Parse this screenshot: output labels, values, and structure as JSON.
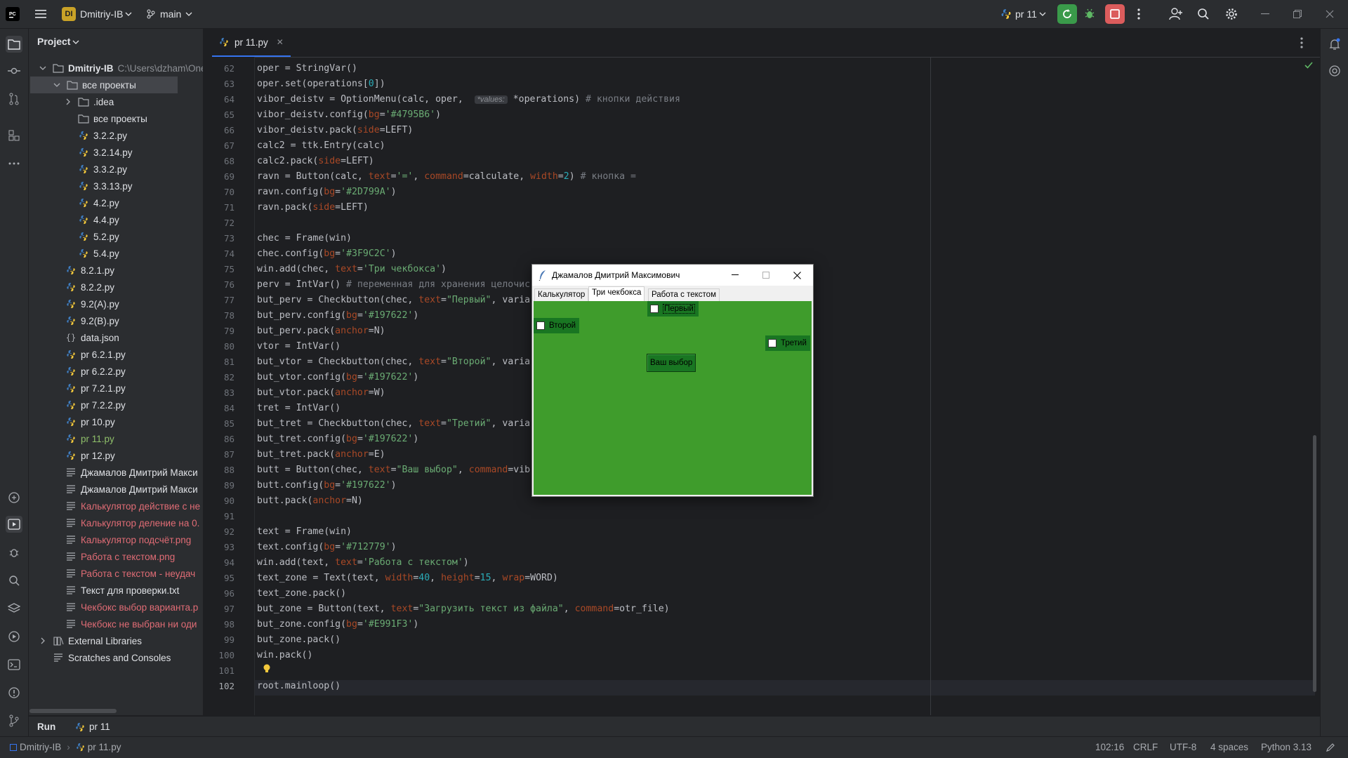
{
  "titlebar": {
    "project_badge": "DI",
    "project_name": "Dmitriy-IB",
    "branch": "main",
    "run_config": "pr 11"
  },
  "project_panel": {
    "title": "Project",
    "root_name": "Dmitriy-IB",
    "root_path": "C:\\Users\\dzham\\One",
    "items": [
      {
        "label": "все проекты",
        "kind": "folder",
        "depth": 1,
        "expanded": true,
        "selected": true
      },
      {
        "label": ".idea",
        "kind": "folder",
        "depth": 2,
        "expanded": false
      },
      {
        "label": "все проекты",
        "kind": "folder",
        "depth": 2
      },
      {
        "label": "3.2.2.py",
        "kind": "py",
        "depth": 2
      },
      {
        "label": "3.2.14.py",
        "kind": "py",
        "depth": 2
      },
      {
        "label": "3.3.2.py",
        "kind": "py",
        "depth": 2
      },
      {
        "label": "3.3.13.py",
        "kind": "py",
        "depth": 2
      },
      {
        "label": "4.2.py",
        "kind": "py",
        "depth": 2
      },
      {
        "label": "4.4.py",
        "kind": "py",
        "depth": 2
      },
      {
        "label": "5.2.py",
        "kind": "py",
        "depth": 2
      },
      {
        "label": "5.4.py",
        "kind": "py",
        "depth": 2
      },
      {
        "label": "8.2.1.py",
        "kind": "py",
        "depth": 1
      },
      {
        "label": "8.2.2.py",
        "kind": "py",
        "depth": 1
      },
      {
        "label": "9.2(A).py",
        "kind": "py",
        "depth": 1
      },
      {
        "label": "9.2(B).py",
        "kind": "py",
        "depth": 1
      },
      {
        "label": "data.json",
        "kind": "json",
        "depth": 1
      },
      {
        "label": "pr 6.2.1.py",
        "kind": "py",
        "depth": 1
      },
      {
        "label": "pr 6.2.2.py",
        "kind": "py",
        "depth": 1
      },
      {
        "label": "pr 7.2.1.py",
        "kind": "py",
        "depth": 1
      },
      {
        "label": "pr 7.2.2.py",
        "kind": "py",
        "depth": 1
      },
      {
        "label": "pr 10.py",
        "kind": "py",
        "depth": 1
      },
      {
        "label": "pr 11.py",
        "kind": "py-active",
        "depth": 1
      },
      {
        "label": "pr 12.py",
        "kind": "py",
        "depth": 1
      },
      {
        "label": "Джамалов Дмитрий Макси",
        "kind": "text",
        "depth": 1
      },
      {
        "label": "Джамалов Дмитрий Макси",
        "kind": "text",
        "depth": 1
      },
      {
        "label": "Калькулятор действие с не",
        "kind": "image",
        "depth": 1
      },
      {
        "label": "Калькулятор деление на 0.",
        "kind": "image",
        "depth": 1
      },
      {
        "label": "Калькулятор подсчёт.png",
        "kind": "image",
        "depth": 1
      },
      {
        "label": "Работа с текстом.png",
        "kind": "image",
        "depth": 1
      },
      {
        "label": "Работа с текстом - неудач",
        "kind": "image",
        "depth": 1
      },
      {
        "label": "Текст для проверки.txt",
        "kind": "text",
        "depth": 1
      },
      {
        "label": "Чекбокс выбор варианта.p",
        "kind": "image",
        "depth": 1
      },
      {
        "label": "Чекбокс не выбран ни оди",
        "kind": "image",
        "depth": 1
      },
      {
        "label": "External Libraries",
        "kind": "lib",
        "depth": 0
      },
      {
        "label": "Scratches and Consoles",
        "kind": "scratch",
        "depth": 0
      }
    ]
  },
  "editor": {
    "tab_label": "pr 11.py",
    "first_line": 62,
    "lines": [
      "oper = StringVar()",
      "oper.set(operations[0])",
      "vibor_deistv = OptionMenu(calc, oper,  *values: *operations) # кнопки действия",
      "vibor_deistv.config(bg='#4795B6')",
      "vibor_deistv.pack(side=LEFT)",
      "calc2 = ttk.Entry(calc)",
      "calc2.pack(side=LEFT)",
      "ravn = Button(calc, text='=', command=calculate, width=2) # кнопка =",
      "ravn.config(bg='#2D799A')",
      "ravn.pack(side=LEFT)",
      "",
      "chec = Frame(win)",
      "chec.config(bg='#3F9C2C')",
      "win.add(chec, text='Три чекбокса')",
      "perv = IntVar() # переменная для хранения целочис",
      "but_perv = Checkbutton(chec, text=\"Первый\", varia",
      "but_perv.config(bg='#197622')",
      "but_perv.pack(anchor=N)",
      "vtor = IntVar()",
      "but_vtor = Checkbutton(chec, text=\"Второй\", varia",
      "but_vtor.config(bg='#197622')",
      "but_vtor.pack(anchor=W)",
      "tret = IntVar()",
      "but_tret = Checkbutton(chec, text=\"Третий\", varia",
      "but_tret.config(bg='#197622')",
      "but_tret.pack(anchor=E)",
      "butt = Button(chec, text=\"Ваш выбор\", command=vib",
      "butt.config(bg='#197622')",
      "butt.pack(anchor=N)",
      "",
      "text = Frame(win)",
      "text.config(bg='#712779')",
      "win.add(text, text='Работа с текстом')",
      "text_zone = Text(text, width=40, height=15, wrap=WORD)",
      "text_zone.pack()",
      "but_zone = Button(text, text=\"Загрузить текст из файла\", command=otr_file)",
      "but_zone.config(bg='#E991F3')",
      "but_zone.pack()",
      "win.pack()",
      "",
      "root.mainloop()"
    ]
  },
  "tk_window": {
    "title": "Джамалов Дмитрий Максимович",
    "tabs": [
      "Калькулятор",
      "Три чекбокса",
      "Работа с текстом"
    ],
    "active_tab": 1,
    "frame_color": "#3F9C2C",
    "widget_color": "#197622",
    "check_first": "Первый",
    "check_second": "Второй",
    "check_third": "Третий",
    "button_label": "Ваш выбор"
  },
  "run_panel": {
    "title": "Run",
    "tab_label": "pr 11"
  },
  "statusbar": {
    "project": "Dmitriy-IB",
    "file": "pr 11.py",
    "position": "102:16",
    "line_sep": "CRLF",
    "encoding": "UTF-8",
    "indent": "4 spaces",
    "interpreter": "Python 3.13"
  },
  "colors": {
    "accent": "#3574f0",
    "run_green": "#3a9a4a",
    "stop_red": "#db5c5c",
    "badge": "#c9a227"
  }
}
